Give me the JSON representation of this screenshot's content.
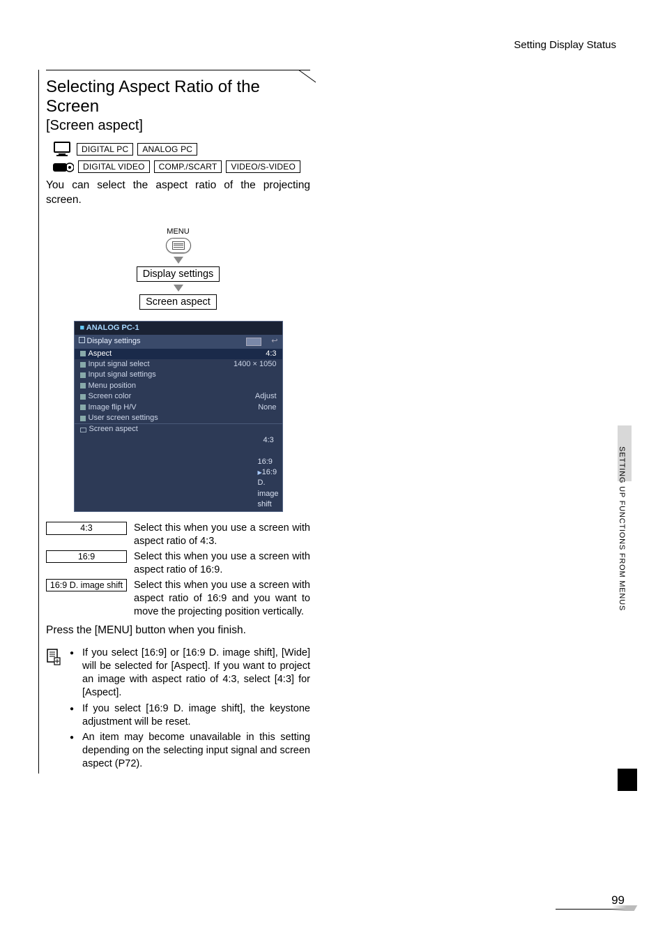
{
  "header": {
    "breadcrumb": "Setting Display Status"
  },
  "section": {
    "title": "Selecting Aspect Ratio of the Screen",
    "subtitle": "[Screen aspect]",
    "signals_pc": [
      "DIGITAL PC",
      "ANALOG PC"
    ],
    "signals_video": [
      "DIGITAL VIDEO",
      "COMP./SCART",
      "VIDEO/S-VIDEO"
    ],
    "intro": "You can select the aspect ratio of the projecting screen."
  },
  "flow": {
    "menu_label": "MENU",
    "step1": "Display settings",
    "step2": "Screen aspect"
  },
  "osd": {
    "source": "ANALOG PC-1",
    "tab": "Display settings",
    "rows": [
      {
        "label": "Aspect",
        "value": "4:3",
        "selected": true
      },
      {
        "label": "Input signal select",
        "value": "1400 × 1050"
      },
      {
        "label": "Input signal settings",
        "value": ""
      },
      {
        "label": "Menu position",
        "value": ""
      },
      {
        "label": "Screen color",
        "value": "Adjust"
      },
      {
        "label": "Image flip H/V",
        "value": "None"
      },
      {
        "label": "User screen settings",
        "value": ""
      }
    ],
    "screen_aspect_label": "Screen aspect",
    "options": [
      "4:3",
      "16:9",
      "16:9 D. image shift"
    ],
    "active_option": "16:9 D. image shift"
  },
  "options": [
    {
      "tag": "4:3",
      "desc": "Select this when you use a screen with aspect ratio of 4:3."
    },
    {
      "tag": "16:9",
      "desc": "Select this when you use a screen with aspect ratio of 16:9."
    },
    {
      "tag": "16:9 D. image shift",
      "desc": "Select this when you use a screen with aspect ratio of 16:9 and you want to move the projecting position vertically."
    }
  ],
  "finish": "Press the [MENU] button when you finish.",
  "notes": [
    "If you select [16:9] or [16:9 D. image shift], [Wide] will be selected for [Aspect]. If you want to project an image with aspect ratio of 4:3, select [4:3] for [Aspect].",
    "If you select [16:9 D. image shift], the keystone adjustment will be reset.",
    "An item may become unavailable in this setting depending on the selecting input signal and screen aspect (P72)."
  ],
  "side_tab": "SETTING UP FUNCTIONS FROM MENUS",
  "page": "99"
}
